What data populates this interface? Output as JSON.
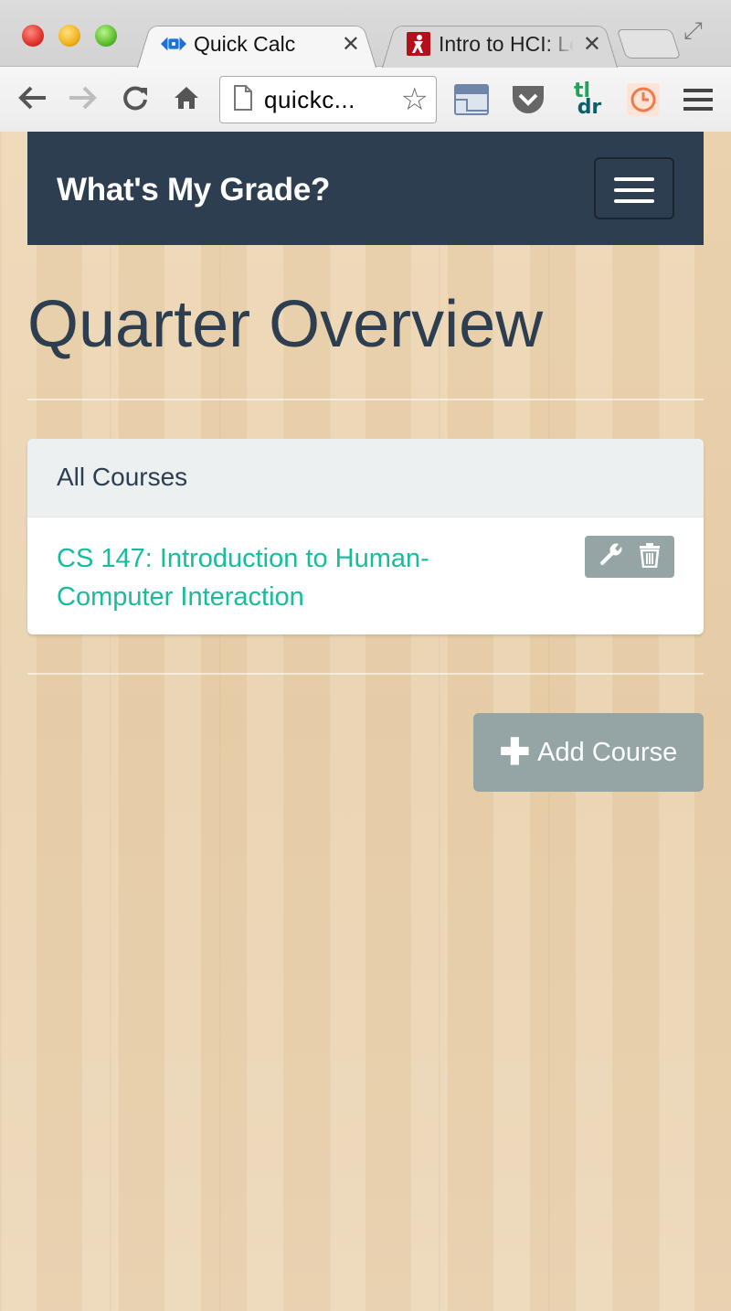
{
  "browser": {
    "tabs": [
      {
        "title": "Quick Calc",
        "icon": "quickcalc-favicon-icon",
        "active": true
      },
      {
        "title": "Intro to HCI: Lo",
        "icon": "hci-favicon-icon",
        "active": false
      }
    ],
    "address_bar": {
      "url": "quickc..."
    },
    "colors": {
      "chrome": "#d6d6d6"
    }
  },
  "app": {
    "brand": "What's My Grade?",
    "colors": {
      "navbar": "#2c3e50",
      "accent": "#18bc9c",
      "muted_button": "#95a5a6"
    }
  },
  "main": {
    "title": "Quarter Overview",
    "panel": {
      "heading": "All Courses",
      "courses": [
        {
          "name": "CS 147: Introduction to Human-Computer Interaction"
        }
      ]
    },
    "add_button_label": "Add Course"
  }
}
